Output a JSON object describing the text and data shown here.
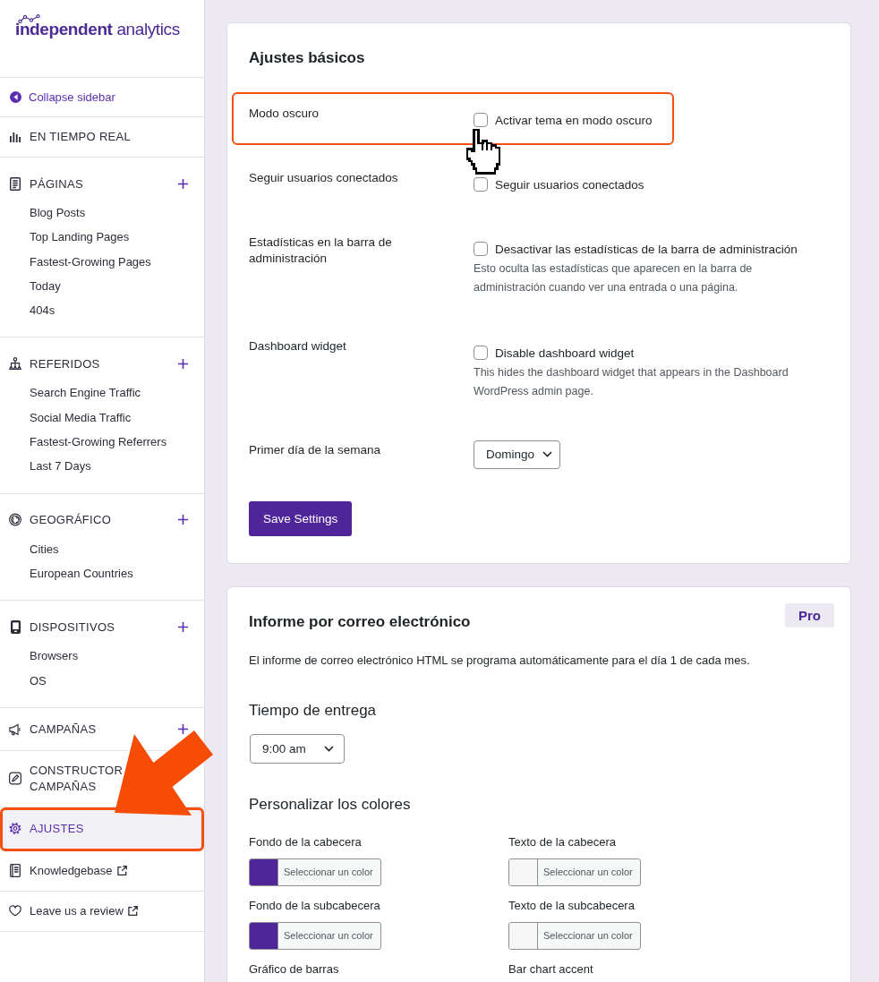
{
  "sidebar": {
    "logo": "**independent** analytics",
    "collapse": "Collapse sidebar",
    "sections": [
      {
        "kind": "link",
        "label": "EN TIEMPO REAL",
        "selected": false,
        "highlighted": false
      },
      {
        "kind": "group",
        "label": "PÁGINAS",
        "selected": false,
        "highlighted": false,
        "items": [
          {
            "label": "Blog Posts",
            "selected": false
          },
          {
            "label": "Top Landing Pages",
            "selected": false
          },
          {
            "label": "Fastest-Growing Pages",
            "selected": false
          },
          {
            "label": "Today",
            "selected": false
          },
          {
            "label": "404s",
            "selected": false
          }
        ]
      },
      {
        "kind": "group",
        "label": "REFERIDOS",
        "selected": false,
        "highlighted": false,
        "items": [
          {
            "label": "Search Engine Traffic",
            "selected": false
          },
          {
            "label": "Social Media Traffic",
            "selected": false
          },
          {
            "label": "Fastest-Growing Referrers",
            "selected": false
          },
          {
            "label": "Last 7 Days",
            "selected": false
          }
        ]
      },
      {
        "kind": "group",
        "label": "GEOGRÁFICO",
        "selected": false,
        "highlighted": false,
        "items": [
          {
            "label": "Cities",
            "selected": false
          },
          {
            "label": "European Countries",
            "selected": false
          }
        ]
      },
      {
        "kind": "group",
        "label": "DISPOSITIVOS",
        "selected": false,
        "highlighted": false,
        "items": [
          {
            "label": "Browsers",
            "selected": false
          },
          {
            "label": "OS",
            "selected": false
          }
        ]
      },
      {
        "kind": "group",
        "label": "CAMPAÑAS",
        "selected": false,
        "highlighted": false
      },
      {
        "kind": "link",
        "label": "CONSTRUCTOR CAMPAÑAS",
        "selected": false,
        "highlighted": false
      },
      {
        "kind": "link",
        "label": "AJUSTES",
        "selected": true,
        "highlighted": true
      },
      {
        "kind": "external",
        "label": "Knowledgebase",
        "selected": false,
        "highlighted": false
      },
      {
        "kind": "external",
        "label": "Leave us a review",
        "selected": false,
        "highlighted": false
      }
    ]
  },
  "basic_settings": {
    "title": "Ajustes básicos",
    "rows": [
      {
        "kind": "checkbox",
        "label": "Modo oscuro",
        "option": "Activar tema en modo oscuro",
        "checked": false,
        "highlighted": true
      },
      {
        "kind": "checkbox",
        "label": "Seguir usuarios conectados",
        "option": "Seguir usuarios conectados",
        "checked": false,
        "highlighted": false
      },
      {
        "kind": "checkbox",
        "label": "Estadísticas en la barra de administración",
        "option": "Desactivar las estadísticas de la barra de administración",
        "checked": false,
        "highlighted": false,
        "help": "Esto oculta las estadísticas que aparecen en la barra de administración cuando ver una entrada o una página."
      },
      {
        "kind": "checkbox",
        "label": "Dashboard widget",
        "option": "Disable dashboard widget",
        "checked": false,
        "highlighted": false,
        "help": "This hides the dashboard widget that appears in the Dashboard WordPress admin page."
      },
      {
        "kind": "select",
        "label": "Primer día de la semana",
        "value": "Domingo",
        "highlighted": false
      }
    ],
    "save_button": "Save Settings"
  },
  "email_report": {
    "title": "Informe por correo electrónico",
    "badge": "Pro",
    "intro": "El informe de correo electrónico HTML se programa automáticamente para el día 1 de cada mes.",
    "delivery": {
      "heading": "Tiempo de entrega",
      "value": "9:00 am"
    },
    "colors": {
      "heading": "Personalizar los colores",
      "pickers": [
        {
          "label": "Fondo de la cabecera",
          "button": "Seleccionar un color",
          "color": "#4f2599"
        },
        {
          "label": "Texto de la cabecera",
          "button": "Seleccionar un color",
          "color": "#f6f6f6"
        },
        {
          "label": "Fondo de la subcabecera",
          "button": "Seleccionar un color",
          "color": "#4f2599"
        },
        {
          "label": "Texto de la subcabecera",
          "button": "Seleccionar un color",
          "color": "#f6f6f6"
        },
        {
          "label": "Gráfico de barras"
        },
        {
          "label": "Bar chart accent"
        }
      ]
    }
  }
}
